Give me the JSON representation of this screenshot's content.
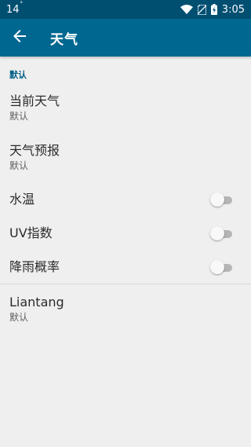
{
  "status_bar": {
    "time_left": "14",
    "time_left_sup": "°",
    "time_right": "3:05",
    "icons": [
      "wifi-icon",
      "no-sim-icon",
      "battery-charging-icon"
    ]
  },
  "app_bar": {
    "back_icon": "arrow-back-icon",
    "title": "天气"
  },
  "section": {
    "header": "默认",
    "items": [
      {
        "title": "当前天气",
        "summary": "默认"
      },
      {
        "title": "天气预报",
        "summary": "默认"
      },
      {
        "title": "水温",
        "switch_on": false
      },
      {
        "title": "UV指数",
        "switch_on": false
      },
      {
        "title": "降雨概率",
        "switch_on": false
      }
    ]
  },
  "location": {
    "title": "Liantang",
    "summary": "默认"
  },
  "colors": {
    "status_bar": "#004f71",
    "app_bar": "#006791",
    "accent": "#005f86",
    "background": "#efefef"
  }
}
